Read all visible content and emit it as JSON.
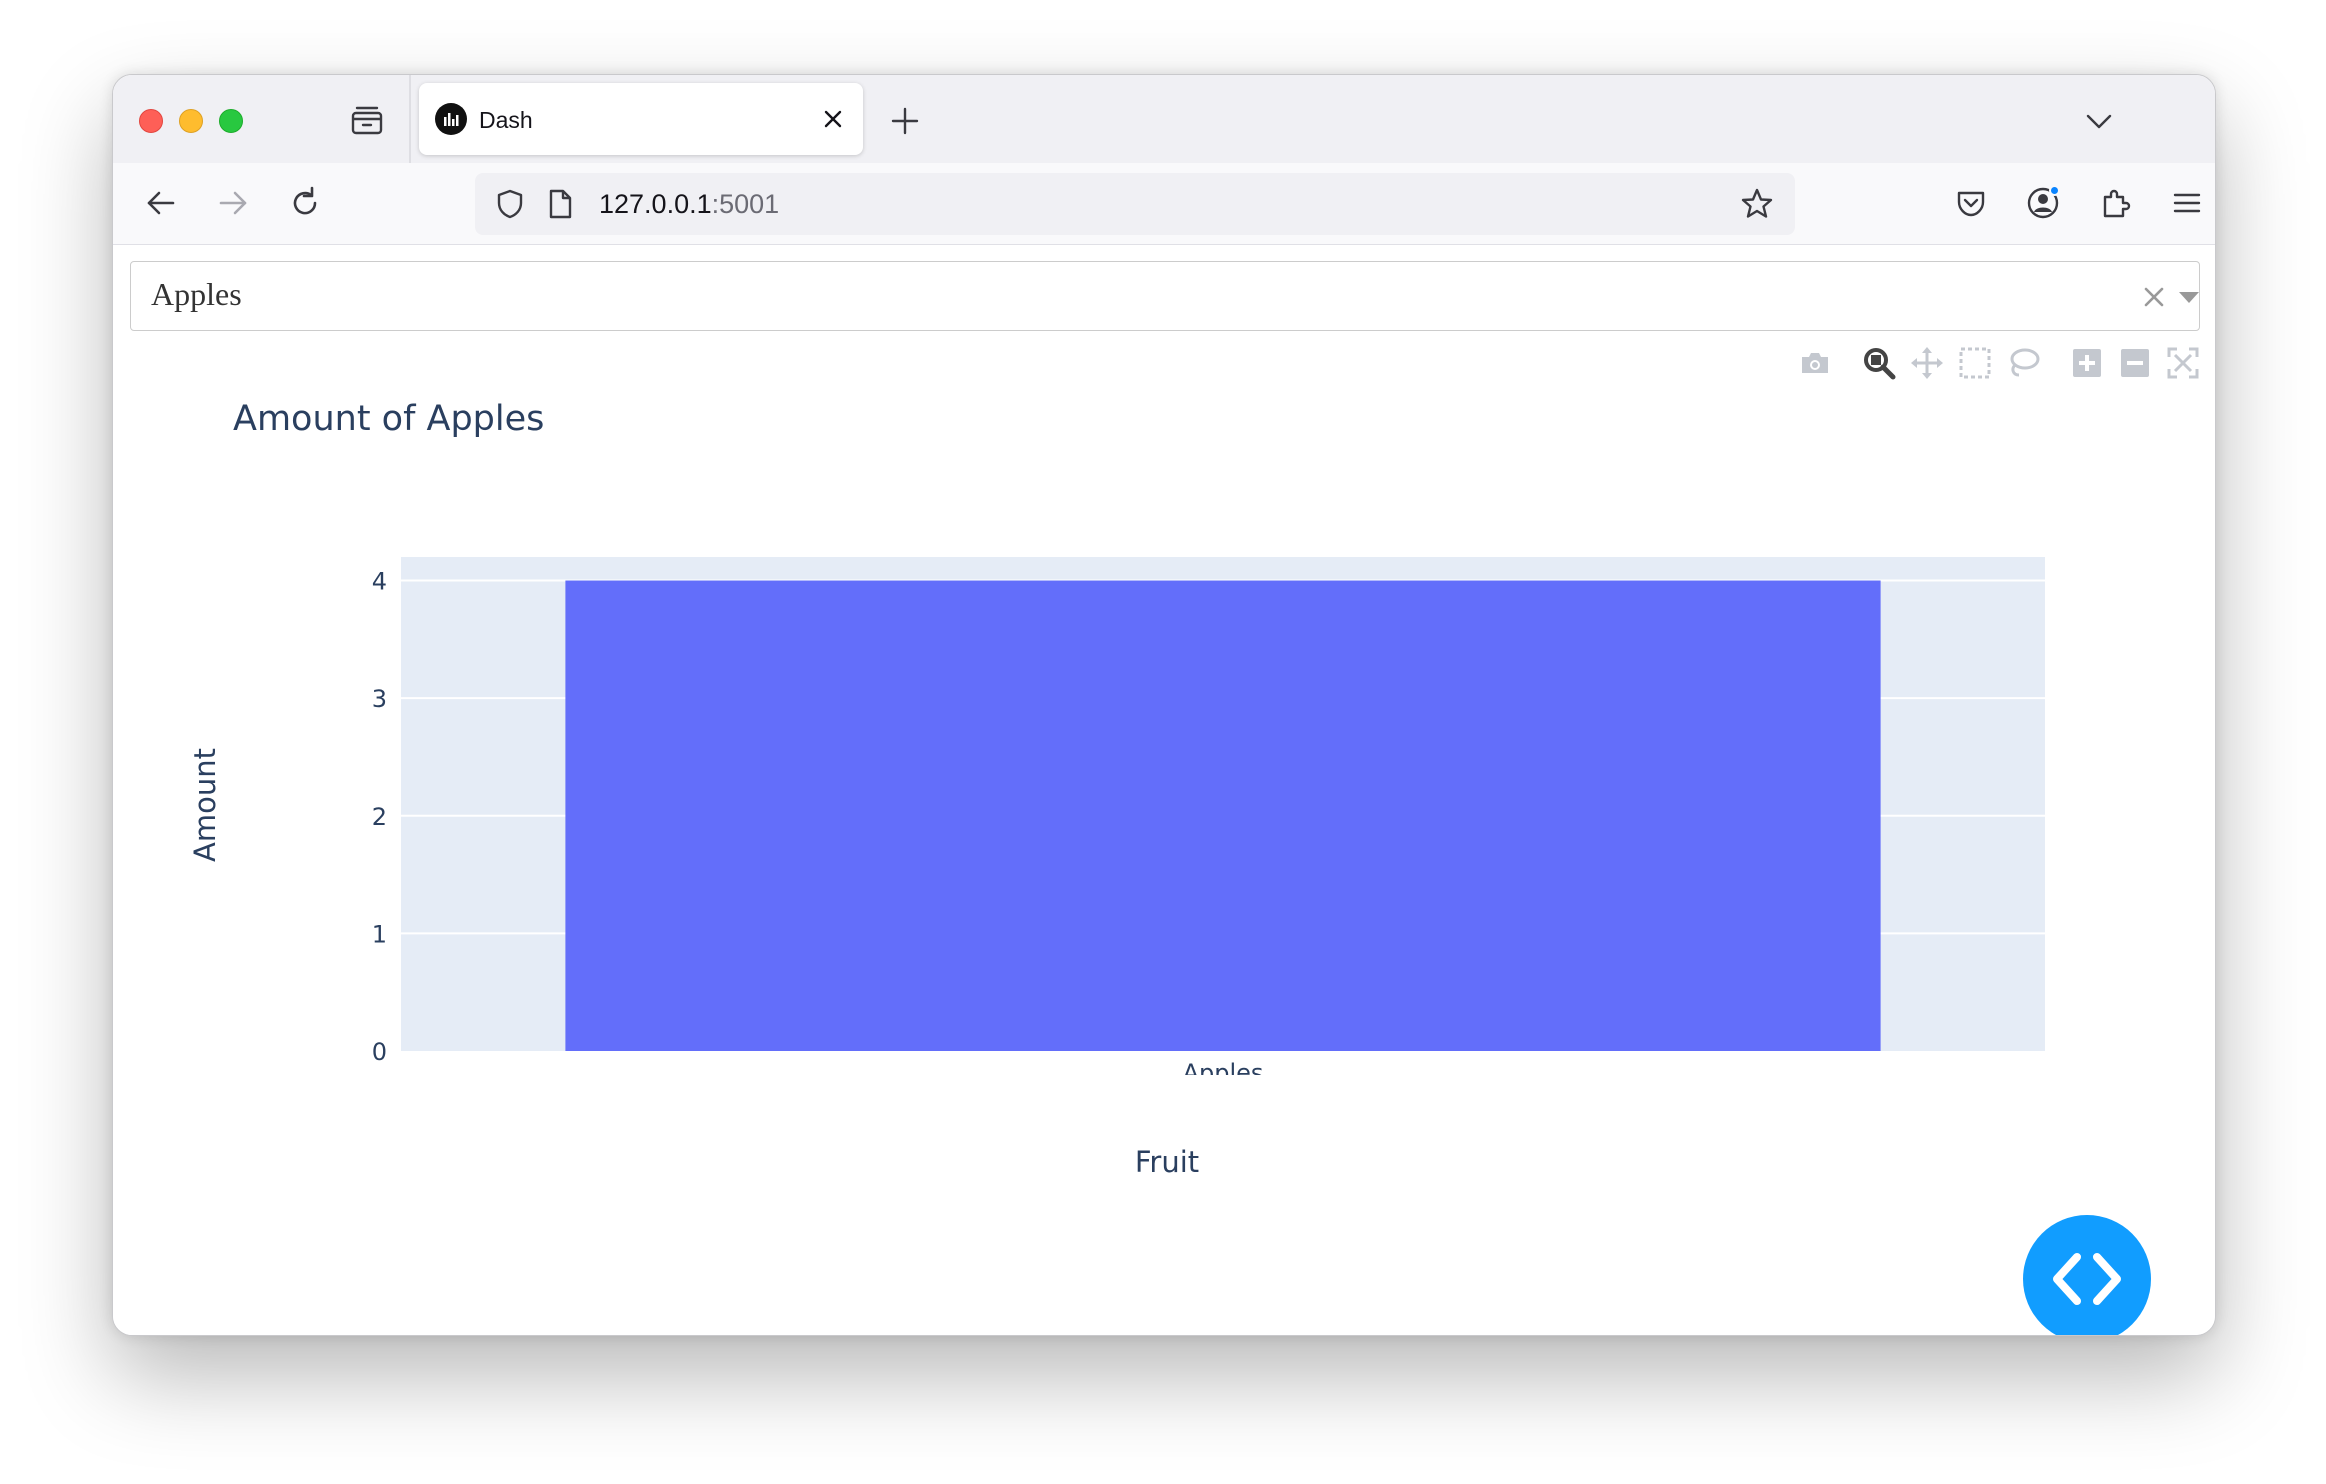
{
  "browser": {
    "tab_title": "Dash",
    "url_host": "127.0.0.1",
    "url_port": ":5001"
  },
  "dropdown": {
    "selected_value": "Apples"
  },
  "modebar": {
    "buttons": [
      "camera-icon",
      "zoom-icon",
      "pan-icon",
      "box-select-icon",
      "lasso-select-icon",
      "zoom-in-icon",
      "zoom-out-icon",
      "autoscale-icon",
      "reset-axes-icon",
      "plotly-logo-icon"
    ]
  },
  "chart_data": {
    "type": "bar",
    "title": "Amount of Apples",
    "xlabel": "Fruit",
    "ylabel": "Amount",
    "categories": [
      "Apples"
    ],
    "values": [
      4
    ],
    "ylim": [
      0,
      4.2
    ],
    "yticks": [
      0,
      1,
      2,
      3,
      4
    ],
    "bar_color": "#636efa",
    "plot_bgcolor": "#e5ecf6",
    "grid": true,
    "legend": "none"
  },
  "colors": {
    "accent": "#119dff",
    "title_text": "#2a3f5f"
  }
}
